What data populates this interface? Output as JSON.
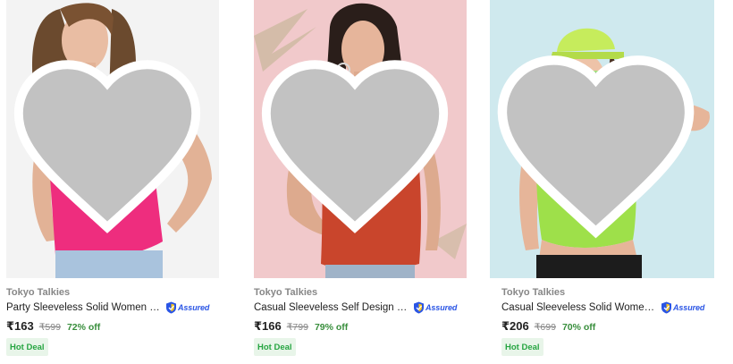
{
  "products": [
    {
      "brand": "Tokyo Talkies",
      "title": "Party Sleeveless Solid Women Pi...",
      "price": "₹163",
      "mrp": "₹599",
      "discount": "72% off",
      "badge": "Hot Deal",
      "assured": "Assured",
      "image_desc": "woman in pink one-shoulder top",
      "top_color": "#ee2d7e"
    },
    {
      "brand": "Tokyo Talkies",
      "title": "Casual Sleeveless Self Design W...",
      "price": "₹166",
      "mrp": "₹799",
      "discount": "79% off",
      "badge": "Hot Deal",
      "assured": "Assured",
      "image_desc": "woman in rust collared sleeveless top",
      "top_color": "#c9452c"
    },
    {
      "brand": "Tokyo Talkies",
      "title": "Casual Sleeveless Solid Women ...",
      "price": "₹206",
      "mrp": "₹699",
      "discount": "70% off",
      "badge": "Hot Deal",
      "assured": "Assured",
      "image_desc": "woman in lime green crop top with cap and sunglasses",
      "top_color": "#9ee04a"
    }
  ],
  "colors": {
    "discount_green": "#388e3c",
    "deal_bg": "#e8f5e9",
    "deal_text": "#26a541",
    "assured_blue": "#2a55e5",
    "wishlist_heart": "#c2c2c2"
  },
  "icons": [
    "wishlist-heart-icon",
    "assured-shield-icon"
  ]
}
